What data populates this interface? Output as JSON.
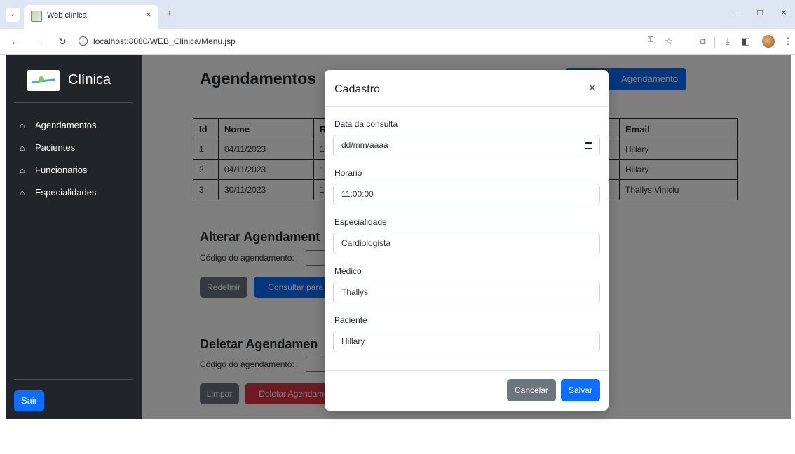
{
  "browser": {
    "tab_title": "Web clínica",
    "tab_close": "×",
    "new_tab": "+",
    "url": "localhost:8080/WEB_Clinica/Menu.jsp",
    "window_controls": [
      "–",
      "□",
      "×"
    ]
  },
  "sidebar": {
    "brand": "Clínica",
    "items": [
      {
        "label": "Agendamentos",
        "icon": "home-icon"
      },
      {
        "label": "Pacientes",
        "icon": "home-icon"
      },
      {
        "label": "Funcionarios",
        "icon": "home-icon"
      },
      {
        "label": "Especialidades",
        "icon": "home-icon"
      }
    ],
    "logout_label": "Sair"
  },
  "main": {
    "title": "Agendamentos",
    "new_button_label": "Agendamento",
    "table": {
      "headers": [
        "Id",
        "Nome",
        "R",
        "Email"
      ],
      "rows": [
        [
          "1",
          "04/11/2023",
          "1",
          "Hillary"
        ],
        [
          "2",
          "04/11/2023",
          "1",
          "Hillary"
        ],
        [
          "3",
          "30/11/2023",
          "1",
          "Thallys Viniciu"
        ]
      ]
    },
    "alterar": {
      "title": "Alterar Agendament",
      "code_label": "Código do agendamento:",
      "reset_label": "Redefinir",
      "consult_label": "Consultar para A"
    },
    "deletar": {
      "title": "Deletar Agendamen",
      "code_label": "Código do agendamento:",
      "clear_label": "Limpar",
      "delete_label": "Deletar Agendame"
    }
  },
  "modal": {
    "title": "Cadastro",
    "close": "×",
    "fields": {
      "data": {
        "label": "Data da consulta",
        "value": "dd/mm/aaaa"
      },
      "horario": {
        "label": "Horario",
        "value": "11:00:00"
      },
      "especialidade": {
        "label": "Especialidade",
        "value": "Cardiologista"
      },
      "medico": {
        "label": "Médico",
        "value": "Thallys"
      },
      "paciente": {
        "label": "Paciente",
        "value": "Hillary"
      }
    },
    "cancel_label": "Cancelar",
    "save_label": "Salvar"
  },
  "colors": {
    "primary": "#0d6efd",
    "secondary": "#6c757d",
    "danger": "#dc3545",
    "sidebar": "#212529"
  }
}
